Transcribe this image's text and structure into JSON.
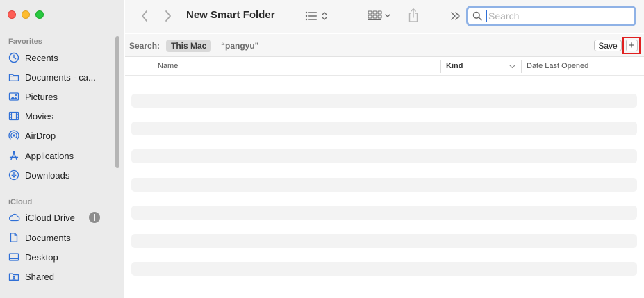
{
  "window": {
    "title": "New Smart Folder"
  },
  "sidebar": {
    "favorites_label": "Favorites",
    "icloud_label": "iCloud",
    "favorites": [
      {
        "label": "Recents",
        "icon": "clock-icon"
      },
      {
        "label": "Documents - ca...",
        "icon": "folder-icon"
      },
      {
        "label": "Pictures",
        "icon": "photo-icon"
      },
      {
        "label": "Movies",
        "icon": "film-icon"
      },
      {
        "label": "AirDrop",
        "icon": "airdrop-icon"
      },
      {
        "label": "Applications",
        "icon": "applications-icon"
      },
      {
        "label": "Downloads",
        "icon": "download-icon"
      }
    ],
    "icloud": [
      {
        "label": "iCloud Drive",
        "icon": "cloud-icon"
      },
      {
        "label": "Documents",
        "icon": "document-icon"
      },
      {
        "label": "Desktop",
        "icon": "desktop-icon"
      },
      {
        "label": "Shared",
        "icon": "shared-folder-icon"
      }
    ]
  },
  "toolbar": {
    "search_placeholder": "Search",
    "search_value": ""
  },
  "scope": {
    "label": "Search:",
    "this_mac": "This Mac",
    "query": "“pangyu”",
    "save_label": "Save",
    "add_label": "+"
  },
  "columns": {
    "name": "Name",
    "kind": "Kind",
    "date": "Date Last Opened"
  },
  "colors": {
    "accent": "#2f6fd6",
    "highlight_box": "#e02020",
    "sidebar_bg": "#ebebeb"
  }
}
